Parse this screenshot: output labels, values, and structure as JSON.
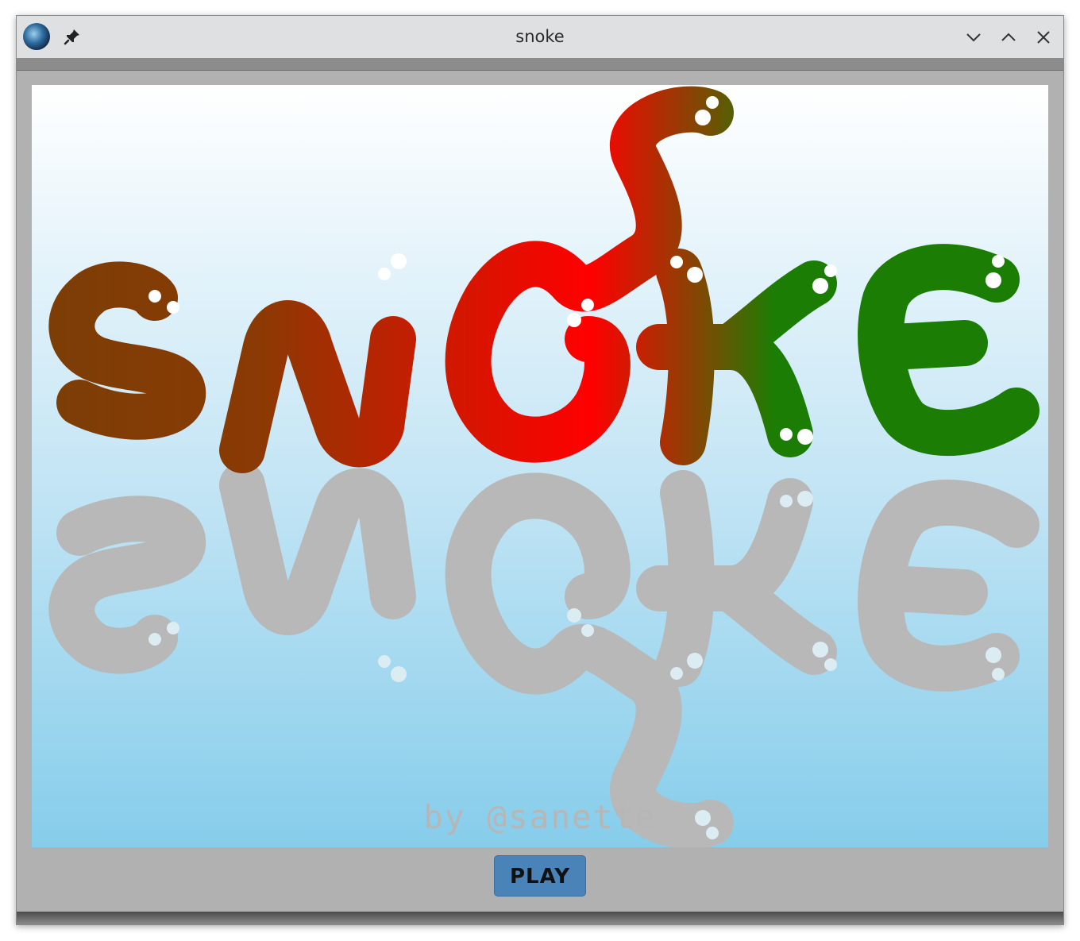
{
  "window": {
    "title": "snoke",
    "app_icon": "globe-icon",
    "pin_icon": "pin-icon",
    "controls": [
      "chevron-down-icon",
      "chevron-up-icon",
      "close-icon"
    ]
  },
  "game": {
    "logo_text": "SNOKE",
    "credit": "by @sanette",
    "play_label": "PLAY",
    "colors": {
      "brown": "#7b3e06",
      "red": "#ff0000",
      "green": "#1b7d03",
      "reflection": "#b8b8b8",
      "sky_top": "#ffffff",
      "sky_bottom": "#86cdeb",
      "button": "#4a83b8"
    }
  }
}
